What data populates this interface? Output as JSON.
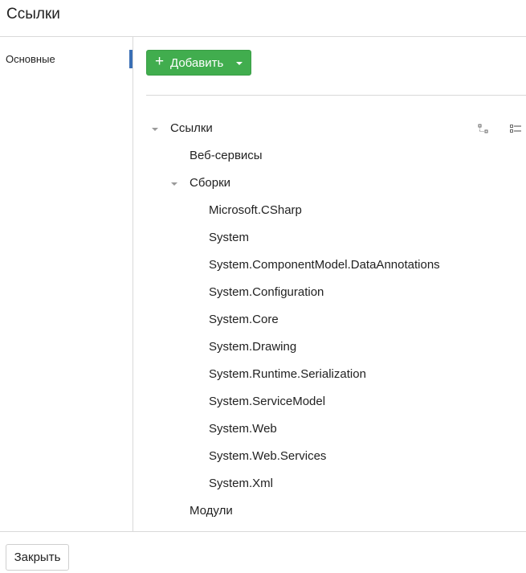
{
  "header": {
    "title": "Ссылки"
  },
  "sidebar": {
    "items": [
      {
        "label": "Основные",
        "active": true
      }
    ]
  },
  "toolbar": {
    "add_label": "Добавить",
    "add_icon": "plus-icon",
    "accent": "#41ad4e"
  },
  "tree": {
    "tools": [
      "collapse-tree-icon",
      "list-view-icon"
    ],
    "root": "Ссылки",
    "web_services": "Веб-сервисы",
    "assemblies": "Сборки",
    "assembly_items": [
      "Microsoft.CSharp",
      "System",
      "System.ComponentModel.DataAnnotations",
      "System.Configuration",
      "System.Core",
      "System.Drawing",
      "System.Runtime.Serialization",
      "System.ServiceModel",
      "System.Web",
      "System.Web.Services",
      "System.Xml"
    ],
    "modules": "Модули"
  },
  "footer": {
    "close_label": "Закрыть"
  }
}
